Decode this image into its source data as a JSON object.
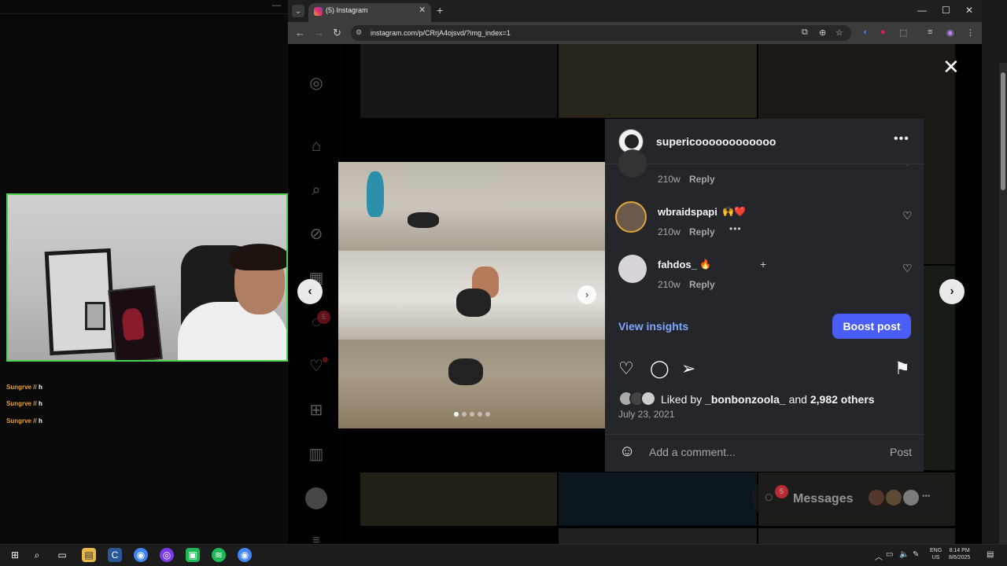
{
  "stream": {
    "chat": [
      {
        "user": "Sungrve",
        "badge": "//",
        "message": "h"
      },
      {
        "user": "Sungrve",
        "badge": "//",
        "message": "h"
      },
      {
        "user": "Sungrve",
        "badge": "//",
        "message": "h"
      }
    ]
  },
  "browser": {
    "tab_title": "(5) Instagram",
    "url": "instagram.com/p/CRrjA4ojsvd/?img_index=1",
    "window_controls": {
      "minimize": "—",
      "maximize": "☐",
      "close": "✕"
    }
  },
  "instagram": {
    "sidebar": {
      "notification_count": "5"
    },
    "post": {
      "username": "supericoooooooooooo",
      "comments": [
        {
          "user": "",
          "emoji": "",
          "age": "210w",
          "reply_label": "Reply"
        },
        {
          "user": "wbraidspapi",
          "emoji": "🙌❤️",
          "age": "210w",
          "reply_label": "Reply"
        },
        {
          "user": "fahdos_",
          "emoji": "🔥",
          "age": "210w",
          "reply_label": "Reply"
        }
      ],
      "view_insights": "View insights",
      "boost_post": "Boost post",
      "liked_prefix": "Liked by ",
      "liked_user": "_bonbonzoola_",
      "liked_and": " and ",
      "liked_others": "2,982 others",
      "date": "July 23, 2021",
      "comment_placeholder": "Add a comment...",
      "post_button": "Post",
      "photo_index": 1,
      "photo_count": 5
    },
    "messages": {
      "label": "Messages",
      "badge": "5"
    }
  },
  "taskbar": {
    "language": "ENG",
    "region": "US",
    "time": "8:14 PM",
    "date": "8/6/2025"
  },
  "colors": {
    "accent_blue": "#4a5df9",
    "link_blue": "#7fa6ff",
    "badge_red": "#ff3040",
    "webcam_border": "#4ad34a"
  }
}
